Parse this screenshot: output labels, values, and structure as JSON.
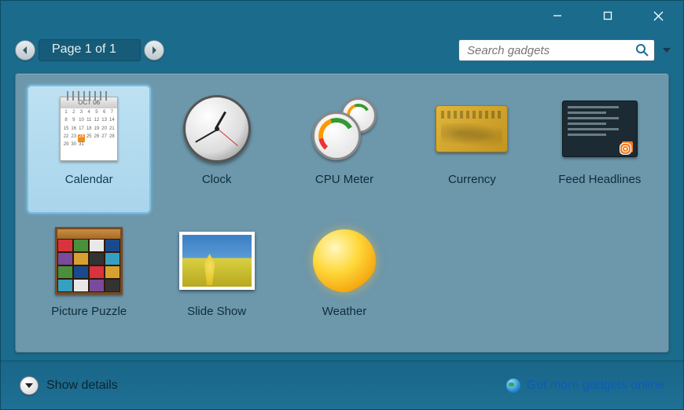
{
  "titlebar": {
    "minimize_icon": "minimize",
    "maximize_icon": "maximize",
    "close_icon": "close"
  },
  "pager": {
    "label": "Page 1 of 1"
  },
  "search": {
    "placeholder": "Search gadgets"
  },
  "gadgets": [
    {
      "name": "Calendar",
      "icon": "calendar",
      "selected": true
    },
    {
      "name": "Clock",
      "icon": "clock",
      "selected": false
    },
    {
      "name": "CPU Meter",
      "icon": "cpu",
      "selected": false
    },
    {
      "name": "Currency",
      "icon": "currency",
      "selected": false
    },
    {
      "name": "Feed Headlines",
      "icon": "feed",
      "selected": false
    },
    {
      "name": "Picture Puzzle",
      "icon": "puzzle",
      "selected": false
    },
    {
      "name": "Slide Show",
      "icon": "slideshow",
      "selected": false
    },
    {
      "name": "Weather",
      "icon": "weather",
      "selected": false
    }
  ],
  "calendar_header": "OCT 06",
  "footer": {
    "show_details": "Show details",
    "more_link": "Get more gadgets online"
  },
  "colors": {
    "window_bg": "#1a6b8c",
    "panel_bg": "#6d97ab",
    "selection": "#a9d5ec",
    "link": "#0b5bbd"
  }
}
